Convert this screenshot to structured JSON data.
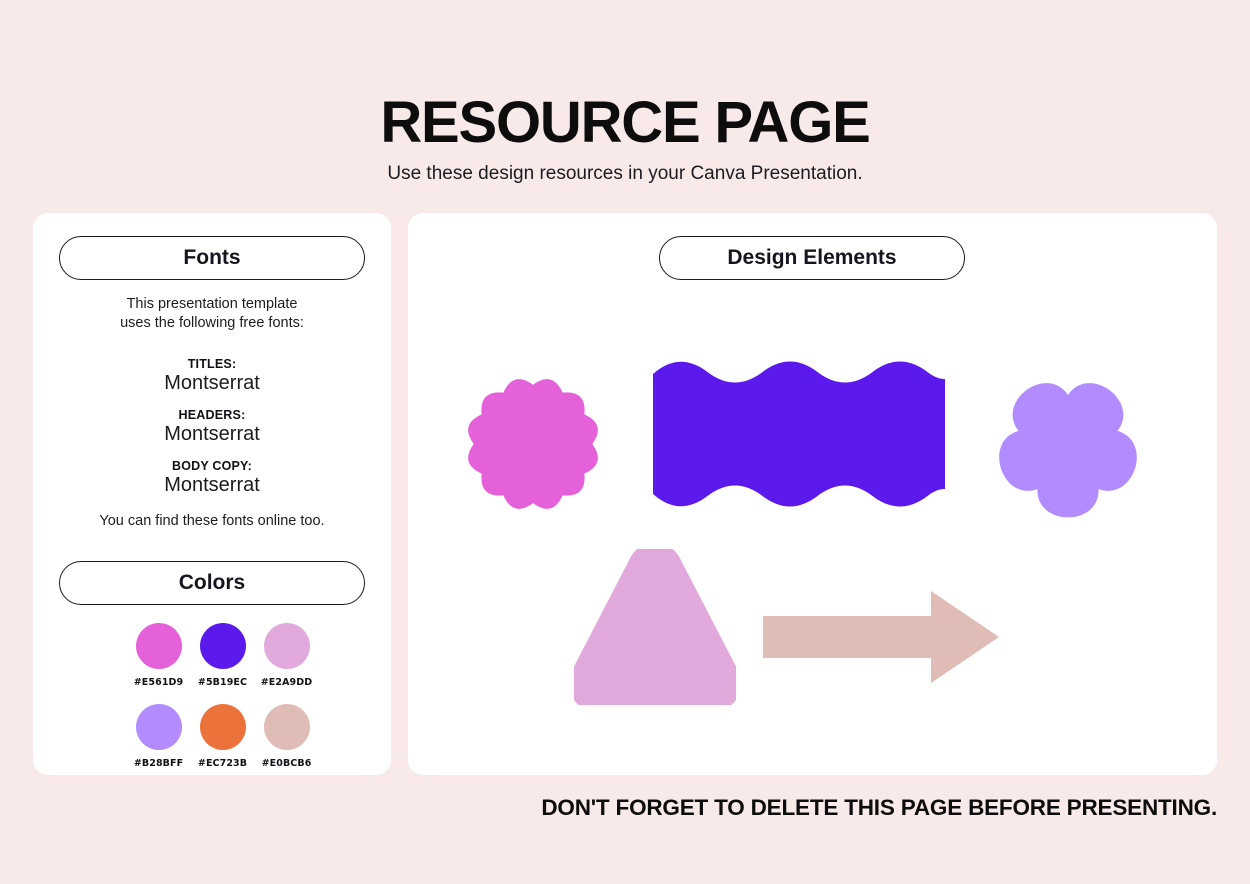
{
  "header": {
    "title": "RESOURCE PAGE",
    "subtitle": "Use these design resources in your Canva Presentation."
  },
  "fonts_panel": {
    "badge_label": "Fonts",
    "intro_line_1": "This presentation template",
    "intro_line_2": "uses the following free fonts:",
    "groups": [
      {
        "role": "TITLES:",
        "font": "Montserrat"
      },
      {
        "role": "HEADERS:",
        "font": "Montserrat"
      },
      {
        "role": "BODY COPY:",
        "font": "Montserrat"
      }
    ],
    "outro": "You can find these fonts online too."
  },
  "colors_panel": {
    "badge_label": "Colors",
    "swatches": [
      {
        "hex": "#E561D9",
        "label": "#E561D9"
      },
      {
        "hex": "#5B19EC",
        "label": "#5B19EC"
      },
      {
        "hex": "#E2A9DD",
        "label": "#E2A9DD"
      },
      {
        "hex": "#B28BFF",
        "label": "#B28BFF"
      },
      {
        "hex": "#EC723B",
        "label": "#EC723B"
      },
      {
        "hex": "#E0BCB6",
        "label": "#E0BCB6"
      }
    ]
  },
  "design_elements_panel": {
    "badge_label": "Design Elements",
    "shapes": [
      {
        "name": "starburst",
        "color": "#E561D9"
      },
      {
        "name": "wavy-rectangle",
        "color": "#5B19EC"
      },
      {
        "name": "flower-blob",
        "color": "#B28BFF"
      },
      {
        "name": "rounded-triangle",
        "color": "#E2A9DD"
      },
      {
        "name": "right-arrow",
        "color": "#E0BCB6"
      }
    ]
  },
  "footer": {
    "note": "DON'T FORGET TO DELETE THIS PAGE BEFORE PRESENTING."
  },
  "theme": {
    "background": "#F9EAEA",
    "panel_background": "#FFFFFF",
    "text_color": "#16161D"
  }
}
